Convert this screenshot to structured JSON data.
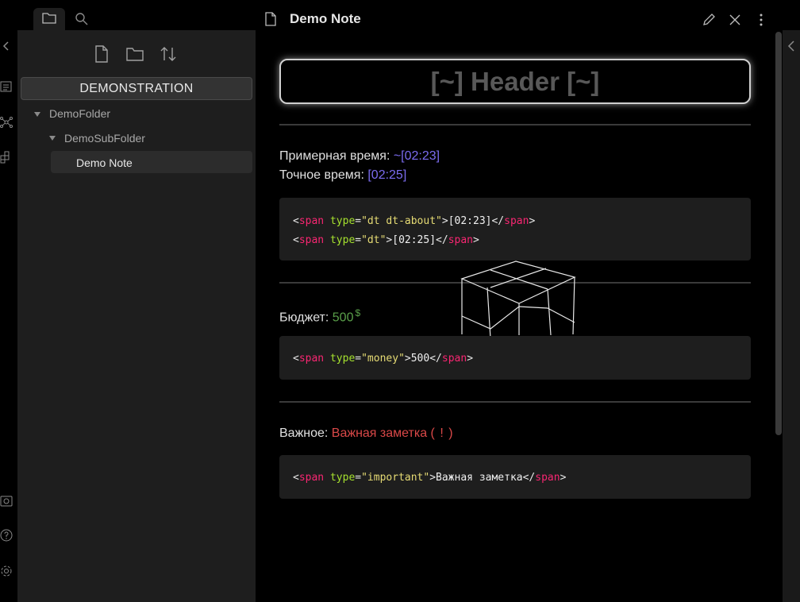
{
  "sidebar": {
    "vault_name": "DEMONSTRATION",
    "tree": [
      {
        "label": "DemoFolder"
      },
      {
        "label": "DemoSubFolder"
      },
      {
        "label": "Demo Note"
      }
    ]
  },
  "note": {
    "title": "Demo Note",
    "header": "[~] Header [~]",
    "approx_label": "Примерная время: ",
    "approx_value": "~[02:23]",
    "exact_label": "Точное время: ",
    "exact_value": "[02:25]",
    "code1": {
      "line1": {
        "tag": "span",
        "attr": "type",
        "val": "\"dt dt-about\"",
        "text": "[02:23]"
      },
      "line2": {
        "tag": "span",
        "attr": "type",
        "val": "\"dt\"",
        "text": "[02:25]"
      }
    },
    "budget_label": "Бюджет: ",
    "budget_value": "500",
    "budget_symbol": "$",
    "code2": {
      "tag": "span",
      "attr": "type",
      "val": "\"money\"",
      "text": "500"
    },
    "important_label": "Важное: ",
    "important_value": "Важная заметка",
    "important_mark": "( ! )",
    "code3": {
      "tag": "span",
      "attr": "type",
      "val": "\"important\"",
      "text": "Важная заметка"
    }
  },
  "colors": {
    "time": "#7b6cf0",
    "money": "#5aa04a",
    "important": "#d94848",
    "tag": "#f92672",
    "attr": "#a6e22e",
    "value": "#e6db74"
  }
}
